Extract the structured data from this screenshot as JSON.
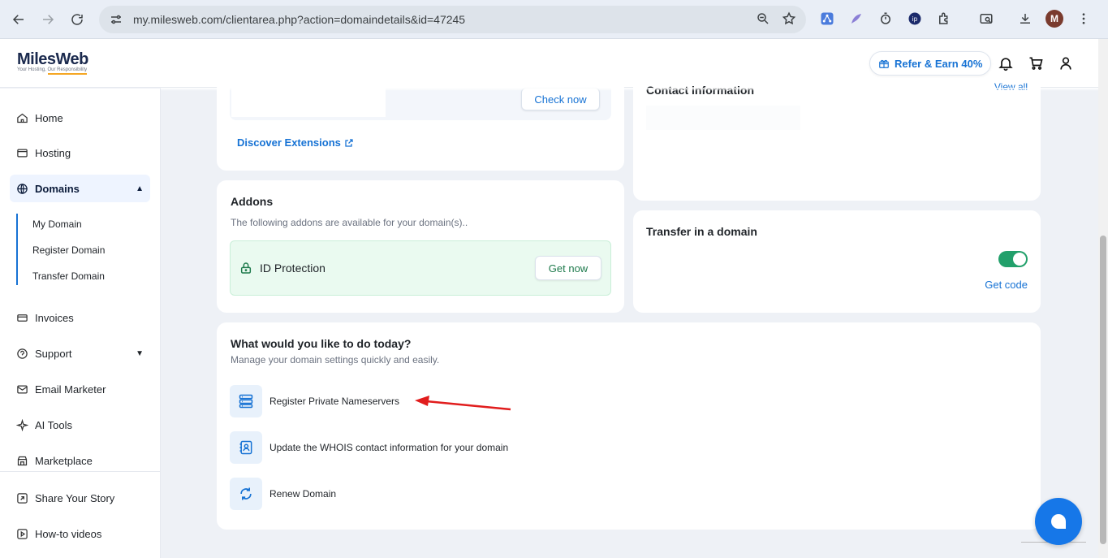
{
  "browser": {
    "url": "my.milesweb.com/clientarea.php?action=domaindetails&id=47245",
    "avatar_letter": "M"
  },
  "header": {
    "brand": "MilesWeb",
    "tagline": "Your Hosting, Our Responsibility",
    "refer_label": "Refer & Earn 40%"
  },
  "sidebar": {
    "items": [
      {
        "label": "Home"
      },
      {
        "label": "Hosting"
      },
      {
        "label": "Domains"
      },
      {
        "label": "Invoices"
      },
      {
        "label": "Support"
      },
      {
        "label": "Email Marketer"
      },
      {
        "label": "AI Tools"
      },
      {
        "label": "Marketplace"
      },
      {
        "label": "Share Your Story"
      },
      {
        "label": "How-to videos"
      }
    ],
    "domain_sub": [
      {
        "label": "My Domain"
      },
      {
        "label": "Register Domain"
      },
      {
        "label": "Transfer Domain"
      }
    ]
  },
  "extensions_card": {
    "check_now": "Check now",
    "discover": "Discover Extensions"
  },
  "contact_card": {
    "title": "Contact information",
    "view_all": "View all"
  },
  "addons_card": {
    "title": "Addons",
    "subtitle": "The following addons are available for your domain(s)..",
    "addon_name": "ID Protection",
    "get_now": "Get now"
  },
  "transfer_card": {
    "title": "Transfer in a domain",
    "get_code": "Get code",
    "toggle_on": true
  },
  "actions_card": {
    "title": "What would you like to do today?",
    "subtitle": "Manage your domain settings quickly and easily.",
    "actions": [
      {
        "label": "Register Private Nameservers"
      },
      {
        "label": "Update the WHOIS contact information for your domain"
      },
      {
        "label": "Renew Domain"
      }
    ]
  },
  "colors": {
    "accent": "#1672d4",
    "toggle": "#22a06b",
    "addon_bg": "#eafaf0",
    "arrow": "#e11d1d"
  }
}
